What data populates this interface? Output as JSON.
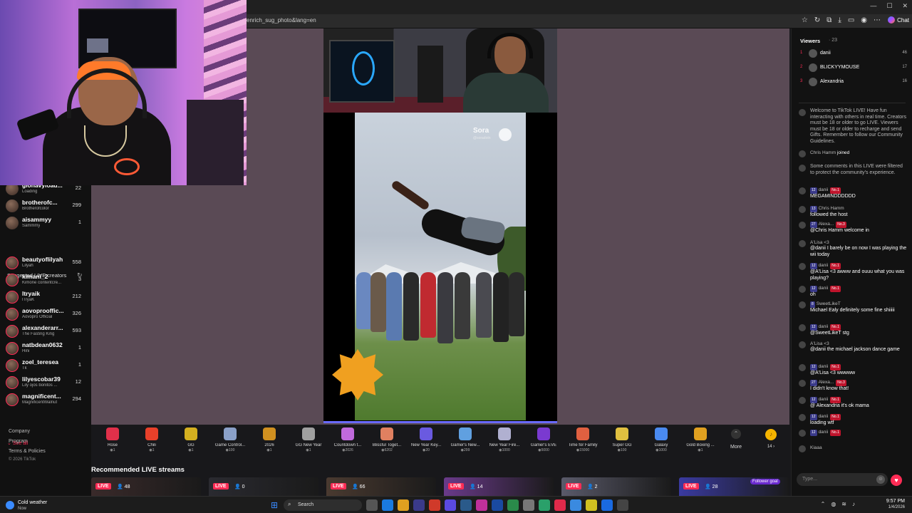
{
  "browser": {
    "url_fragment": "enrich_sug_photo&lang=en",
    "chat_label": "Chat"
  },
  "sidebar": {
    "top_accounts": [
      {
        "name": "glonavyload...",
        "sub": "Loading",
        "count": "22"
      },
      {
        "name": "brotherofc...",
        "sub": "Brotherofcolor",
        "count": "299"
      },
      {
        "name": "aisammyy",
        "sub": "Sammmy",
        "count": "1"
      }
    ],
    "suggested_title": "Suggested LIVE creators",
    "suggested": [
      {
        "name": "beautyoflilyah",
        "sub": "Lilyah",
        "count": "558"
      },
      {
        "name": "kimani_2",
        "sub": "Kimone contentcre...",
        "count": "3"
      },
      {
        "name": "ltryaik",
        "sub": "lTryaK",
        "count": "212"
      },
      {
        "name": "aovoprooffic...",
        "sub": "Aovopro Official",
        "count": "326"
      },
      {
        "name": "alexanderarr...",
        "sub": "The Fasting King",
        "count": "593"
      },
      {
        "name": "natbdean0632",
        "sub": "Hini",
        "count": "1"
      },
      {
        "name": "zoel_teresea",
        "sub": "Tk",
        "count": "1"
      },
      {
        "name": "lilyescobar39",
        "sub": "Lily ojos bonitos ...",
        "count": "12"
      },
      {
        "name": "magnificent...",
        "sub": "MagnificentWalnut",
        "count": "294"
      }
    ],
    "see_all": "See all",
    "footer": [
      "Company",
      "Program",
      "Terms & Policies",
      "© 2026 TikTok"
    ]
  },
  "video": {
    "watermark": "Sora",
    "watermark_sub": "@soradotn",
    "progress": 1.0
  },
  "gifts": [
    {
      "label": "Rose",
      "price": "1",
      "color": "#e0304a"
    },
    {
      "label": "Chili",
      "price": "1",
      "color": "#e8402a"
    },
    {
      "label": "GG",
      "price": "1",
      "color": "#d4b020"
    },
    {
      "label": "Game Control...",
      "price": "100",
      "color": "#8aa0c8"
    },
    {
      "label": "2026",
      "price": "1",
      "color": "#d09020"
    },
    {
      "label": "GG New Year",
      "price": "1",
      "color": "#a0a0a0"
    },
    {
      "label": "Countdown t...",
      "price": "2026",
      "color": "#c06adc"
    },
    {
      "label": "Blissful Toget...",
      "price": "6202",
      "color": "#e08060"
    },
    {
      "label": "New Year Key...",
      "price": "20",
      "color": "#6a5ae0"
    },
    {
      "label": "Gamer's New...",
      "price": "299",
      "color": "#60a0e0"
    },
    {
      "label": "New Year Fire...",
      "price": "1000",
      "color": "#b0b0d0"
    },
    {
      "label": "Gamer's EVE",
      "price": "5000",
      "color": "#7a3ad0"
    },
    {
      "label": "Time for Family",
      "price": "15000",
      "color": "#e06040"
    },
    {
      "label": "Super GG",
      "price": "100",
      "color": "#e0c040"
    },
    {
      "label": "Galaxy",
      "price": "1000",
      "color": "#4a8af0"
    },
    {
      "label": "Gold Boxing ...",
      "price": "1",
      "color": "#e0a020"
    }
  ],
  "gifts_more": "More",
  "coins": "14",
  "recommended": {
    "title": "Recommended LIVE streams",
    "live_label": "LIVE",
    "cards": [
      {
        "viewers": "48",
        "color": "#3a2a2a"
      },
      {
        "viewers": "0",
        "color": "#2a2a30"
      },
      {
        "viewers": "66",
        "color": "#4a3a30"
      },
      {
        "viewers": "14",
        "color": "#6a3a8a"
      },
      {
        "viewers": "2",
        "color": "#5a5a6a"
      },
      {
        "viewers": "28",
        "color": "#3a3aa0"
      }
    ],
    "follower_goal": "Follower goal"
  },
  "chat": {
    "viewers_title": "Viewers",
    "viewers_count": "· 23",
    "top_viewers": [
      {
        "rank": "1",
        "name": "danii",
        "score": "46"
      },
      {
        "rank": "2",
        "name": "BLICKYYMOUSE",
        "score": "17"
      },
      {
        "rank": "3",
        "name": "Alexandria",
        "score": "16"
      }
    ],
    "messages": [
      {
        "kind": "sys",
        "text": "Welcome to TikTok LIVE! Have fun interacting with others in real time. Creators must be 18 or older to go LIVE. Viewers must be 18 or older to recharge and send Gifts. Remember to follow our Community Guidelines."
      },
      {
        "kind": "join",
        "user": "Chris Hamm",
        "text": "joined"
      },
      {
        "kind": "sys",
        "text": "Some comments in this LIVE were filtered to protect the community's experience."
      },
      {
        "kind": "msg",
        "level": "12",
        "user": "danii",
        "top": "No.1",
        "text": "MEGAMINDDDDDD"
      },
      {
        "kind": "msg",
        "level": "13",
        "user": "Chris Hamm",
        "top": "",
        "text": "followed the host"
      },
      {
        "kind": "msg",
        "level": "27",
        "user": "Alexa...",
        "top": "No.3",
        "text": "@Chris Hamm welcome in"
      },
      {
        "kind": "msg",
        "level": "",
        "user": "A'Lisa <3",
        "top": "",
        "text": "@danii I barely be on now I was playing the wii today"
      },
      {
        "kind": "msg",
        "level": "12",
        "user": "danii",
        "top": "No.1",
        "text": "@A'Lisa <3 awww and ouuu what you was playing?"
      },
      {
        "kind": "msg",
        "level": "12",
        "user": "danii",
        "top": "No.1",
        "text": "oh"
      },
      {
        "kind": "msg",
        "level": "8",
        "user": "SweetLikeT",
        "top": "",
        "text": "Michael Ealy definitely some fine shiiiii"
      },
      {
        "kind": "msg",
        "level": "12",
        "user": "danii",
        "top": "No.1",
        "text": "@SweetLikeT stg"
      },
      {
        "kind": "msg",
        "level": "",
        "user": "A'Lisa <3",
        "top": "",
        "text": "@danii the michael jackson dance game"
      },
      {
        "kind": "msg",
        "level": "12",
        "user": "danii",
        "top": "No.1",
        "text": "@A'Lisa <3 wwwww"
      },
      {
        "kind": "msg",
        "level": "27",
        "user": "Alexa...",
        "top": "No.3",
        "text": "I didn't know that!"
      },
      {
        "kind": "msg",
        "level": "12",
        "user": "danii",
        "top": "No.1",
        "text": "@ Alexandria it's ok mama"
      },
      {
        "kind": "msg",
        "level": "12",
        "user": "danii",
        "top": "No.1",
        "text": "loading wtf"
      },
      {
        "kind": "msg",
        "level": "12",
        "user": "danii",
        "top": "No.1",
        "text": ""
      },
      {
        "kind": "msg",
        "level": "",
        "user": "Kiaaa",
        "top": "",
        "text": ""
      }
    ],
    "type_placeholder": "Type..."
  },
  "taskbar": {
    "weather": "Cold weather",
    "weather_sub": "Now",
    "search": "Search",
    "time": "9:57 PM",
    "date": "1/4/2026"
  }
}
